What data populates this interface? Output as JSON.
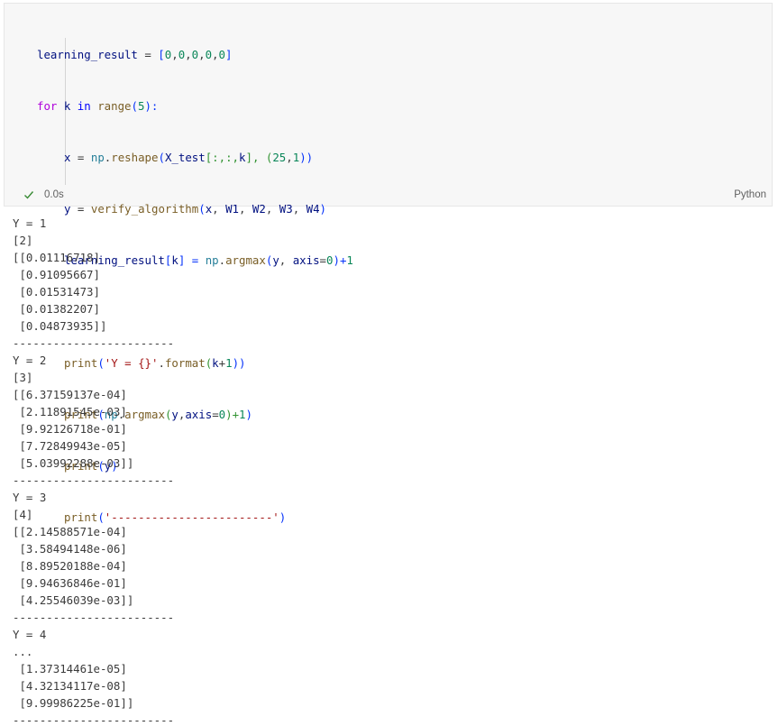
{
  "code_cell": {
    "language": "Python",
    "status": {
      "icon": "check-icon",
      "exec_time": "0.0s"
    }
  },
  "output": {
    "lines": [
      "Y = 1",
      "[2]",
      "[[0.01116718]",
      " [0.91095667]",
      " [0.01531473]",
      " [0.01382207]",
      " [0.04873935]]",
      "------------------------",
      "Y = 2",
      "[3]",
      "[[6.37159137e-04]",
      " [2.11891545e-03]",
      " [9.92126718e-01]",
      " [7.72849943e-05]",
      " [5.03992288e-03]]",
      "------------------------",
      "Y = 3",
      "[4]",
      "[[2.14588571e-04]",
      " [3.58494148e-06]",
      " [8.89520188e-04]",
      " [9.94636846e-01]",
      " [4.25546039e-03]]",
      "------------------------",
      "Y = 4",
      "...",
      " [1.37314461e-05]",
      " [4.32134117e-08]",
      " [9.99986225e-01]]",
      "------------------------"
    ]
  },
  "code_tokens": {
    "l1": [
      "learning_result",
      " = ",
      "[",
      "0",
      ",",
      "0",
      ",",
      "0",
      ",",
      "0",
      ",",
      "0",
      "]"
    ],
    "l2": [
      "for",
      " ",
      "k",
      " ",
      "in",
      " ",
      "range",
      "(",
      "5",
      "):"
    ],
    "l3": [
      "x",
      " = ",
      "np",
      ".",
      "reshape",
      "(",
      "X_test",
      "[:,:,",
      "k",
      "], ",
      "(",
      "25",
      ",",
      "1",
      "))"
    ],
    "l4": [
      "y",
      " = ",
      "verify_algorithm",
      "(",
      "x",
      ", ",
      "W1",
      ", ",
      "W2",
      ", ",
      "W3",
      ", ",
      "W4",
      ")"
    ],
    "l5": [
      "learning_result",
      "[",
      "k",
      "] = ",
      "np",
      ".",
      "argmax",
      "(",
      "y",
      ", ",
      "axis",
      "=",
      "0",
      ")+",
      "1"
    ],
    "l7": [
      "print",
      "(",
      "'Y = {}'",
      ".",
      "format",
      "(",
      "k",
      "+",
      "1",
      "))"
    ],
    "l8": [
      "print",
      "(",
      "np",
      ".",
      "argmax",
      "(",
      "y",
      ",",
      "axis",
      "=",
      "0",
      ")+",
      "1",
      ")"
    ],
    "l9": [
      "print",
      "(",
      "y",
      ")"
    ],
    "l10": [
      "print",
      "(",
      "'------------------------'",
      ")"
    ]
  }
}
